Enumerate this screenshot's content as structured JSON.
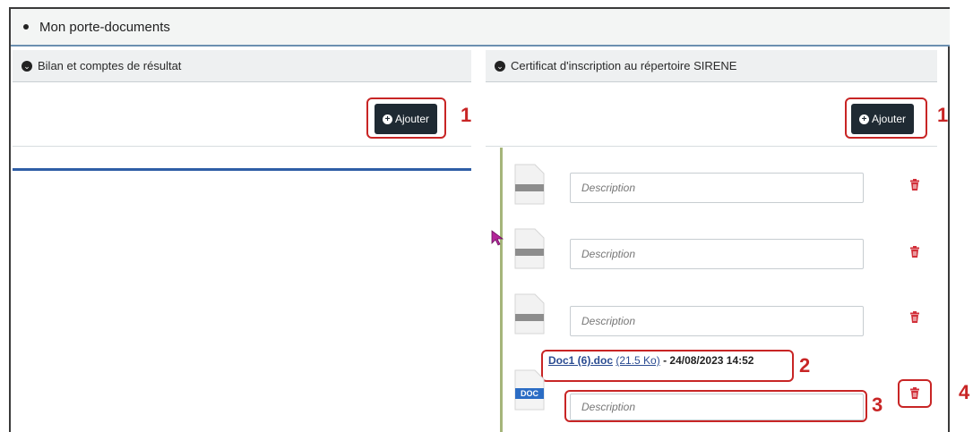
{
  "section_title": "Mon porte-documents",
  "left_panel": {
    "title": "Bilan et comptes de résultat",
    "add_label": "Ajouter",
    "marker": "1"
  },
  "right_panel": {
    "title": "Certificat d'inscription au répertoire SIRENE",
    "add_label": "Ajouter",
    "marker": "1",
    "rows": [
      {
        "placeholder": "Description"
      },
      {
        "placeholder": "Description"
      },
      {
        "placeholder": "Description"
      }
    ],
    "uploaded": {
      "name": "Doc1 (6).doc",
      "size": "(21.5 Ko)",
      "date": "- 24/08/2023 14:52",
      "badge": "DOC",
      "placeholder": "Description",
      "marker_file": "2",
      "marker_desc": "3",
      "marker_delete": "4"
    }
  },
  "icons": [
    "chevron-down-circle-icon",
    "plus-circle-icon",
    "file-icon",
    "trash-icon",
    "cursor-icon"
  ],
  "colors": {
    "accent": "#1f2a33",
    "highlight": "#c82525",
    "link": "#2b4c92",
    "delete": "#d2303a"
  }
}
